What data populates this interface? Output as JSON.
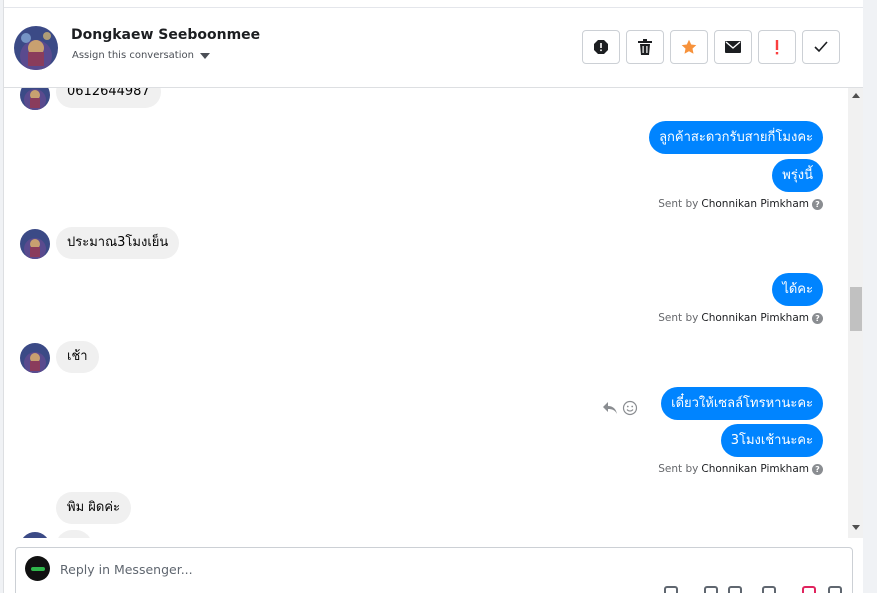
{
  "header": {
    "contact_name": "Dongkaew Seeboonmee",
    "assign_label": "Assign this conversation",
    "avatar_icon": "contact-avatar",
    "actions": [
      {
        "name": "spam-icon"
      },
      {
        "name": "trash-icon"
      },
      {
        "name": "star-icon",
        "color": "#f7923b"
      },
      {
        "name": "mail-icon"
      },
      {
        "name": "important-icon",
        "color": "#fa3e3e"
      },
      {
        "name": "check-icon"
      }
    ]
  },
  "thread": {
    "accent_color": "#0084ff",
    "messages": [
      {
        "from": "contact",
        "text": "0612644987"
      },
      {
        "from": "page",
        "text": "ลูกค้าสะดวกรับสายกี่โมงคะ"
      },
      {
        "from": "page",
        "text": "พรุ่งนี้"
      },
      {
        "from": "contact",
        "text": "ประมาณ3โมงเย็น"
      },
      {
        "from": "page",
        "text": "ได้คะ"
      },
      {
        "from": "contact",
        "text": "เช้า"
      },
      {
        "from": "page",
        "text": "เดี๋ยวให้เซลล์โทรหานะคะ"
      },
      {
        "from": "page",
        "text": "3โมงเช้านะคะ"
      },
      {
        "from": "contact",
        "text": "พิม ผิดค่ะ"
      }
    ],
    "sent_by_prefix": "Sent by",
    "sent_by_name": "Chonnikan Pimkham",
    "help_glyph": "?"
  },
  "composer": {
    "placeholder": "Reply in Messenger..."
  }
}
